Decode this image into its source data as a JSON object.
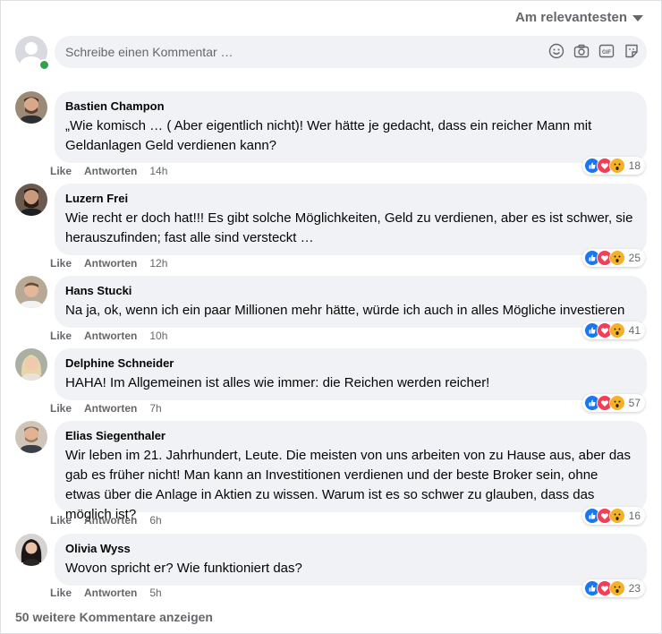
{
  "sort": {
    "label": "Am relevantesten",
    "icon": "caret-down-icon"
  },
  "composer": {
    "placeholder": "Schreibe einen Kommentar …",
    "icons": [
      "emoji-icon",
      "camera-icon",
      "gif-icon",
      "sticker-icon"
    ]
  },
  "actions": {
    "like": "Like",
    "reply": "Antworten"
  },
  "colors": {
    "like": "#1877f2",
    "love": "#f33e58",
    "wow": "#f7b125",
    "bubble": "#f0f2f5",
    "muted": "#65676b"
  },
  "comments": [
    {
      "author": "Bastien Champon",
      "text": "„Wie komisch … ( Aber eigentlich nicht)! Wer hätte je gedacht, dass ein reicher Mann mit Geldanlagen Geld verdienen kann?",
      "time": "14h",
      "reactions": "18",
      "avatar_color": "#7a5a3c"
    },
    {
      "author": "Luzern Frei",
      "text": "Wie recht er doch hat!!! Es gibt solche Möglichkeiten, Geld zu verdienen, aber es ist schwer, sie herauszufinden; fast alle sind versteckt …",
      "time": "12h",
      "reactions": "25",
      "avatar_color": "#4a3a30"
    },
    {
      "author": "Hans Stucki",
      "text": "Na ja, ok, wenn ich ein paar Millionen mehr hätte, würde ich auch in alles Mögliche investieren",
      "time": "10h",
      "reactions": "41",
      "avatar_color": "#8a6a55"
    },
    {
      "author": "Delphine Schneider",
      "text": "HAHA! Im Allgemeinen ist alles wie immer: die Reichen werden reicher!",
      "time": "7h",
      "reactions": "57",
      "avatar_color": "#c9b79a"
    },
    {
      "author": "Elias Siegenthaler",
      "text": "Wir leben im 21. Jahrhundert, Leute. Die meisten von uns arbeiten von zu Hause aus, aber das gab es früher nicht! Man kann an Investitionen verdienen und der beste Broker sein, ohne etwas über die Anlage in Aktien zu wissen. Warum ist es so schwer zu glauben, dass das möglich ist?",
      "time": "6h",
      "reactions": "16",
      "avatar_color": "#a8826a"
    },
    {
      "author": "Olivia Wyss",
      "text": "Wovon spricht er? Wie funktioniert das?",
      "time": "5h",
      "reactions": "23",
      "avatar_color": "#2e2a2a"
    }
  ],
  "more_comments": "50 weitere Kommentare anzeigen"
}
